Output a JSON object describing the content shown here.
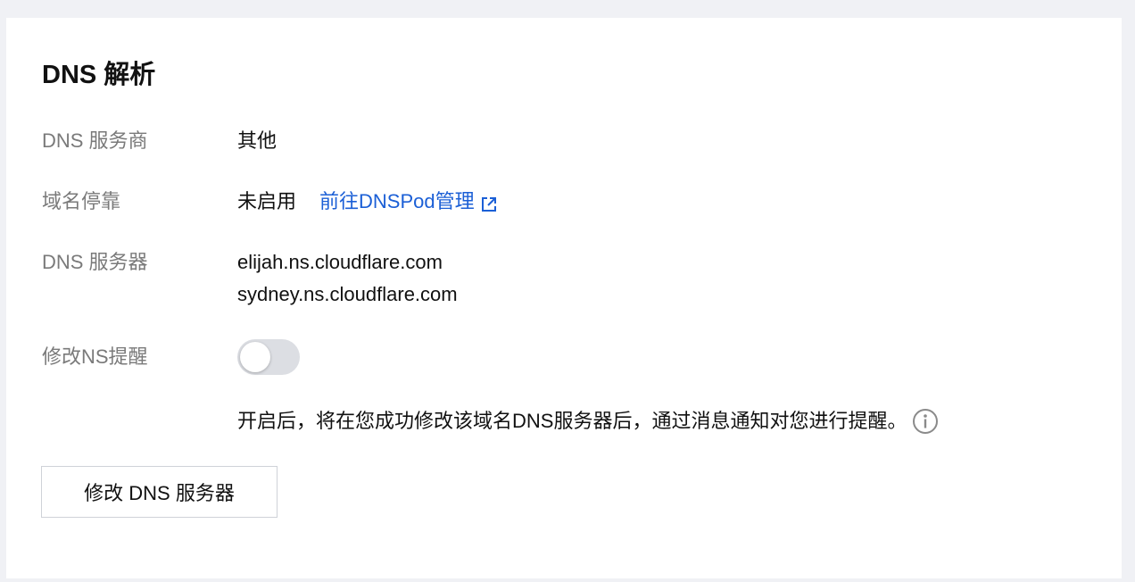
{
  "section": {
    "title": "DNS 解析"
  },
  "rows": {
    "provider": {
      "label": "DNS 服务商",
      "value": "其他"
    },
    "parking": {
      "label": "域名停靠",
      "value": "未启用",
      "link": "前往DNSPod管理"
    },
    "servers": {
      "label": "DNS 服务器",
      "values": [
        "elijah.ns.cloudflare.com",
        "sydney.ns.cloudflare.com"
      ]
    },
    "reminder": {
      "label": "修改NS提醒",
      "enabled": false
    }
  },
  "hint": {
    "text": "开启后，将在您成功修改该域名DNS服务器后，通过消息通知对您进行提醒。"
  },
  "actions": {
    "modify_label": "修改 DNS 服务器"
  },
  "colors": {
    "link": "#1b5fd6",
    "label": "#7a7a7a",
    "toggle_off": "#dcdee3"
  },
  "icons": {
    "link_icon": "external-link-icon",
    "hint_icon": "info-icon"
  }
}
